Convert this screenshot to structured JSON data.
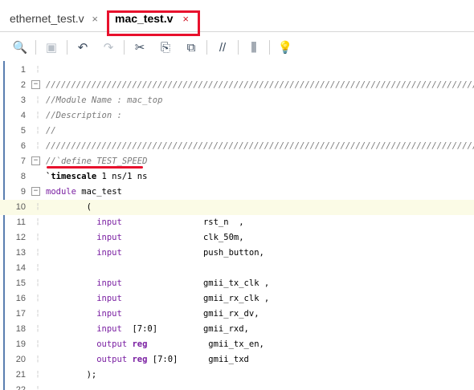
{
  "tabs": [
    {
      "label": "ethernet_test.v",
      "close": "×"
    },
    {
      "label": "mac_test.v",
      "close": "×"
    }
  ],
  "toolbar": [
    {
      "icon": "search-icon",
      "glyph": "🔍"
    },
    {
      "icon": "save-icon",
      "glyph": "▣",
      "disabled": true
    },
    {
      "icon": "undo-icon",
      "glyph": "↶"
    },
    {
      "icon": "redo-icon",
      "glyph": "↷",
      "disabled": true
    },
    {
      "icon": "cut-icon",
      "glyph": "✂"
    },
    {
      "icon": "copy-icon",
      "glyph": "⎘"
    },
    {
      "icon": "paste-icon",
      "glyph": "⧉"
    },
    {
      "icon": "comment-toggle-icon",
      "glyph": "//"
    },
    {
      "icon": "column-select-icon",
      "glyph": "⫼"
    },
    {
      "icon": "lightbulb-icon",
      "glyph": "💡"
    }
  ],
  "editor": {
    "current_line": 10,
    "lines": [
      {
        "n": "1",
        "dash": true,
        "parts": []
      },
      {
        "n": "2",
        "fold": true,
        "parts": [
          {
            "c": "cmt",
            "t": "////////////////////////////////////////////////////////////////////////////////////////////"
          }
        ]
      },
      {
        "n": "3",
        "dash": true,
        "parts": [
          {
            "c": "cmt",
            "t": "//Module Name : mac_top"
          }
        ]
      },
      {
        "n": "4",
        "dash": true,
        "parts": [
          {
            "c": "cmt",
            "t": "//Description :"
          }
        ]
      },
      {
        "n": "5",
        "dash": true,
        "parts": [
          {
            "c": "cmt",
            "t": "//"
          }
        ]
      },
      {
        "n": "6",
        "dash": true,
        "parts": [
          {
            "c": "cmt",
            "t": "////////////////////////////////////////////////////////////////////////////////////////////"
          }
        ]
      },
      {
        "n": "7",
        "fold": true,
        "parts": [
          {
            "c": "cmt",
            "t": "//`define TEST_SPEED"
          }
        ]
      },
      {
        "n": "8",
        "parts": [
          {
            "c": "sys",
            "t": "`timescale"
          },
          {
            "c": "txt",
            "t": " 1 ns/1 ns"
          }
        ]
      },
      {
        "n": "9",
        "fold": true,
        "parts": [
          {
            "c": "kw",
            "t": "module"
          },
          {
            "c": "txt",
            "t": " mac_test"
          }
        ]
      },
      {
        "n": "10",
        "dash": true,
        "parts": [
          {
            "c": "txt",
            "t": "        ("
          }
        ]
      },
      {
        "n": "11",
        "dash": true,
        "parts": [
          {
            "c": "kw",
            "t": "          input"
          },
          {
            "c": "txt",
            "t": "                rst_n  ,"
          }
        ]
      },
      {
        "n": "12",
        "dash": true,
        "parts": [
          {
            "c": "kw",
            "t": "          input"
          },
          {
            "c": "txt",
            "t": "                clk_50m,"
          }
        ]
      },
      {
        "n": "13",
        "dash": true,
        "parts": [
          {
            "c": "kw",
            "t": "          input"
          },
          {
            "c": "txt",
            "t": "                push_button,"
          }
        ]
      },
      {
        "n": "14",
        "dash": true,
        "parts": []
      },
      {
        "n": "15",
        "dash": true,
        "parts": [
          {
            "c": "kw",
            "t": "          input"
          },
          {
            "c": "txt",
            "t": "                gmii_tx_clk ,"
          }
        ]
      },
      {
        "n": "16",
        "dash": true,
        "parts": [
          {
            "c": "kw",
            "t": "          input"
          },
          {
            "c": "txt",
            "t": "                gmii_rx_clk ,"
          }
        ]
      },
      {
        "n": "17",
        "dash": true,
        "parts": [
          {
            "c": "kw",
            "t": "          input"
          },
          {
            "c": "txt",
            "t": "                gmii_rx_dv,"
          }
        ]
      },
      {
        "n": "18",
        "dash": true,
        "parts": [
          {
            "c": "kw",
            "t": "          input"
          },
          {
            "c": "txt",
            "t": "  [7:0]         gmii_rxd,"
          }
        ]
      },
      {
        "n": "19",
        "dash": true,
        "parts": [
          {
            "c": "kw",
            "t": "          output "
          },
          {
            "c": "kwb",
            "t": "reg"
          },
          {
            "c": "txt",
            "t": "            gmii_tx_en,"
          }
        ]
      },
      {
        "n": "20",
        "dash": true,
        "parts": [
          {
            "c": "kw",
            "t": "          output "
          },
          {
            "c": "kwb",
            "t": "reg"
          },
          {
            "c": "txt",
            "t": " [7:0]      gmii_txd"
          }
        ]
      },
      {
        "n": "21",
        "dash": true,
        "parts": [
          {
            "c": "txt",
            "t": "        );"
          }
        ]
      },
      {
        "n": "22",
        "dash": true,
        "parts": []
      }
    ]
  }
}
